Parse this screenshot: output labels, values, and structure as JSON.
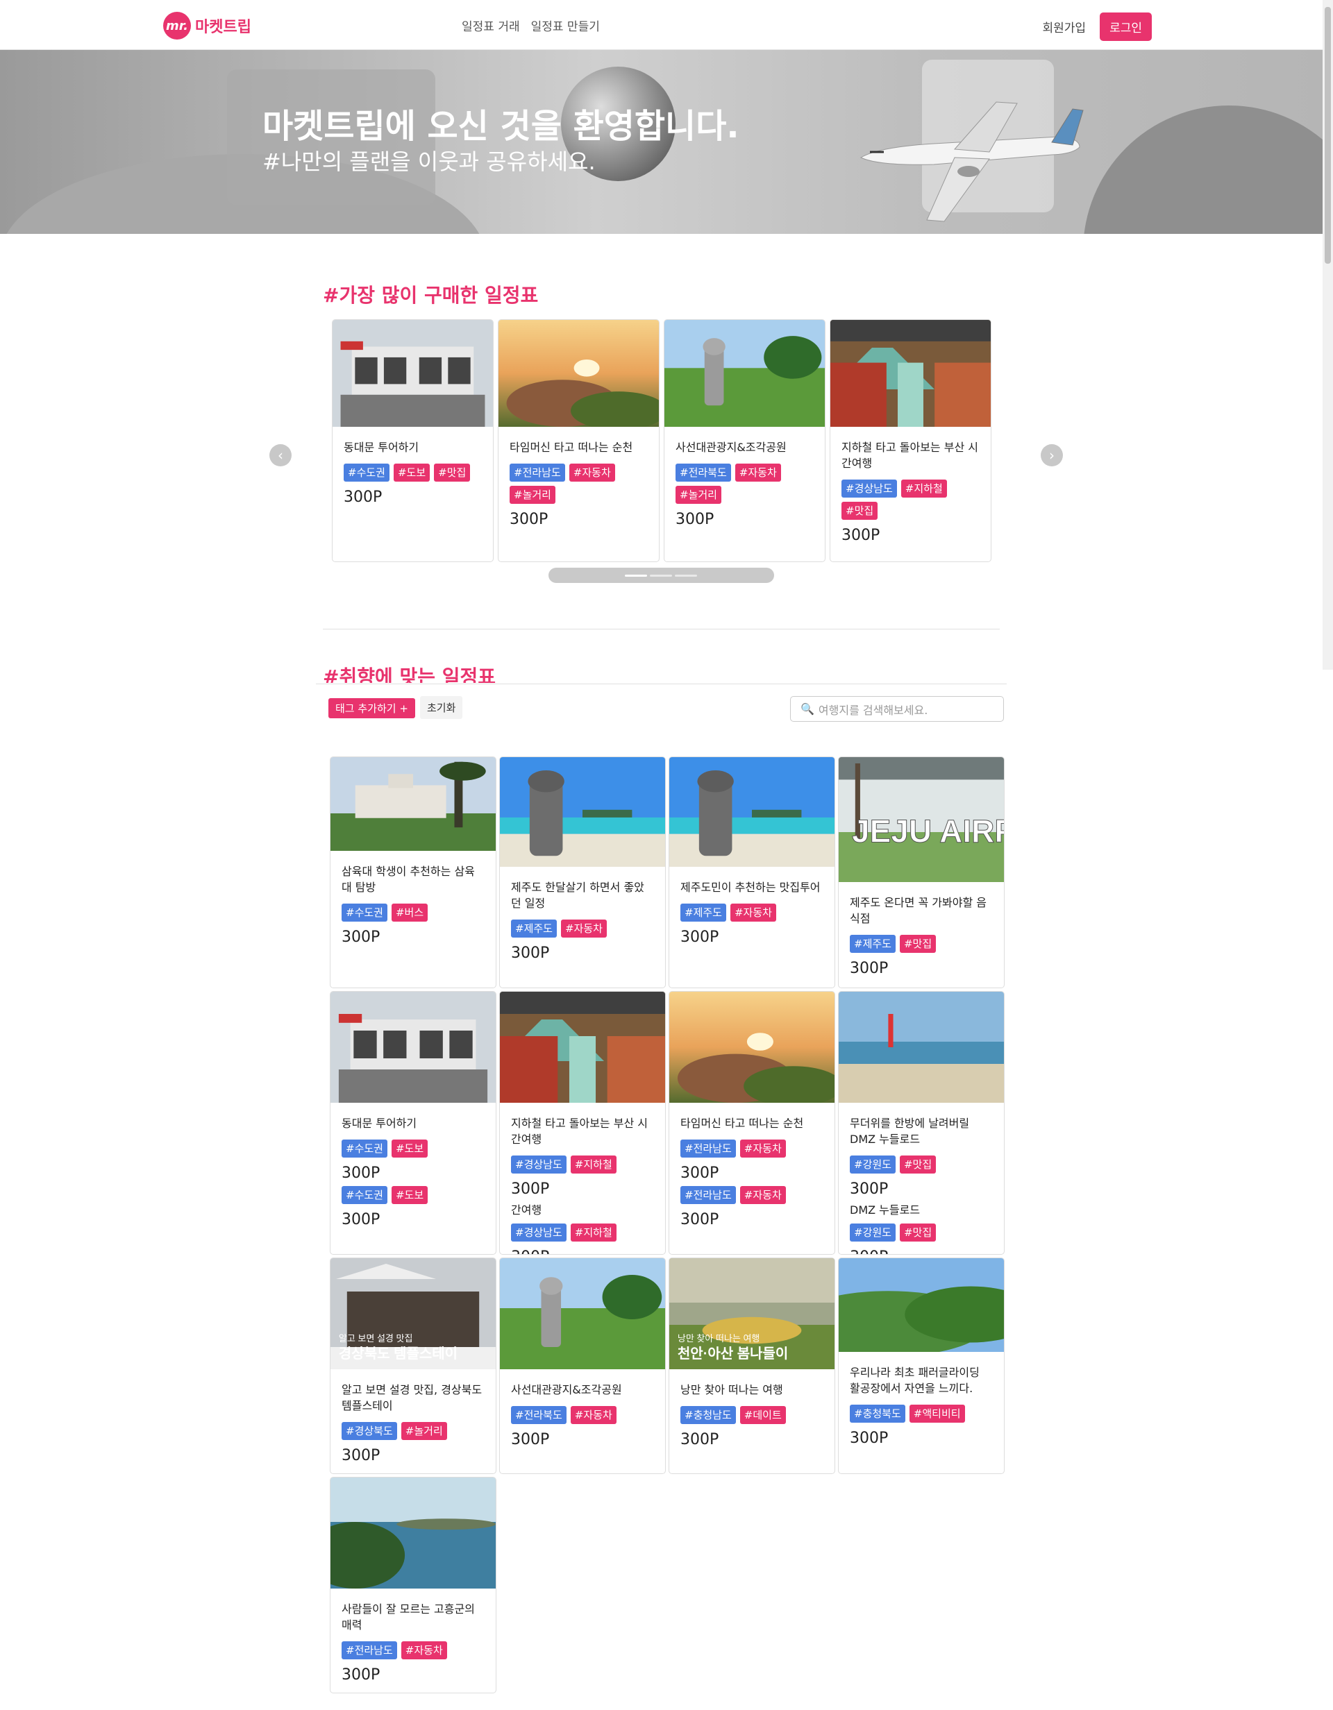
{
  "nav": {
    "logo_badge": "mr.",
    "logo_text": "마켓트립",
    "links": [
      "일정표 거래",
      "일정표 만들기"
    ],
    "signup": "회원가입",
    "login": "로그인"
  },
  "hero": {
    "title": "마켓트립에 오신 것을 환영합니다.",
    "subtitle": "#나만의 플랜을 이웃과 공유하세요."
  },
  "popular": {
    "title": "#가장 많이 구매한 일정표",
    "prev": "‹",
    "next": "›",
    "cards": [
      {
        "title": "동대문 투어하기",
        "tags": [
          [
            "#수도권",
            "blue"
          ],
          [
            "#도보",
            "pink"
          ],
          [
            "#맛집",
            "pink"
          ]
        ],
        "price": "300P",
        "img": "market"
      },
      {
        "title": "타임머신 타고 떠나는 순천",
        "tags": [
          [
            "#전라남도",
            "blue"
          ],
          [
            "#자동차",
            "pink"
          ],
          [
            "#놀거리",
            "pink"
          ]
        ],
        "price": "300P",
        "img": "sunset"
      },
      {
        "title": "사선대관광지&조각공원",
        "tags": [
          [
            "#전라북도",
            "blue"
          ],
          [
            "#자동차",
            "pink"
          ],
          [
            "#놀거리",
            "pink"
          ]
        ],
        "price": "300P",
        "img": "park"
      },
      {
        "title": "지하철 타고 돌아보는 부산 시간여행",
        "tags": [
          [
            "#경상남도",
            "blue"
          ],
          [
            "#지하철",
            "pink"
          ],
          [
            "#맛집",
            "pink"
          ]
        ],
        "price": "300P",
        "img": "fishmarket"
      }
    ]
  },
  "section2": {
    "title": "#취향에 맞는 일정표",
    "add_tag": "태그 추가하기 +",
    "reset": "초기화",
    "search_placeholder": "여행지를 검색해보세요."
  },
  "grid": [
    {
      "title": "삼육대 학생이 추천하는 삼육대 탐방",
      "tags": [
        [
          "#수도권",
          "blue"
        ],
        [
          "#버스",
          "pink"
        ]
      ],
      "price": "300P",
      "img": "campus"
    },
    {
      "title": "제주도 한달살기 하면서 좋았던 일정",
      "tags": [
        [
          "#제주도",
          "blue"
        ],
        [
          "#자동차",
          "pink"
        ]
      ],
      "price": "300P",
      "img": "jeju"
    },
    {
      "title": "제주도민이 추천하는 맛집투어",
      "tags": [
        [
          "#제주도",
          "blue"
        ],
        [
          "#자동차",
          "pink"
        ]
      ],
      "price": "300P",
      "img": "jeju"
    },
    {
      "title": "제주도 온다면 꼭 가봐야할 음식점",
      "tags": [
        [
          "#제주도",
          "blue"
        ],
        [
          "#맛집",
          "pink"
        ]
      ],
      "price": "300P",
      "img": "airport"
    },
    {
      "title": "동대문 투어하기",
      "tags": [
        [
          "#수도권",
          "blue"
        ],
        [
          "#도보",
          "pink"
        ]
      ],
      "price": "300P",
      "img": "market"
    },
    {
      "title": "지하철 타고 돌아보는 부산 시간여행",
      "tags": [
        [
          "#경상남도",
          "blue"
        ],
        [
          "#지하철",
          "pink"
        ]
      ],
      "price": "300P",
      "img": "fishmarket"
    },
    {
      "title": "타임머신 타고 떠나는 순천",
      "tags": [
        [
          "#전라남도",
          "blue"
        ],
        [
          "#자동차",
          "pink"
        ]
      ],
      "price": "300P",
      "img": "sunset"
    },
    {
      "title": "무더위를 한방에 날려버릴 DMZ 누들로드",
      "tags": [
        [
          "#강원도",
          "blue"
        ],
        [
          "#맛집",
          "pink"
        ]
      ],
      "price": "300P",
      "img": "beach"
    },
    {
      "title": "알고 보면 설경 맛집, 경상북도 템플스테이",
      "tags": [
        [
          "#경상북도",
          "blue"
        ],
        [
          "#놀거리",
          "pink"
        ]
      ],
      "price": "300P",
      "img": "temple"
    },
    {
      "title": "사선대관광지&조각공원",
      "tags": [
        [
          "#전라북도",
          "blue"
        ],
        [
          "#자동차",
          "pink"
        ]
      ],
      "price": "300P",
      "img": "park"
    },
    {
      "title": "낭만 찾아 떠나는 여행",
      "tags": [
        [
          "#충청남도",
          "blue"
        ],
        [
          "#데이트",
          "pink"
        ]
      ],
      "price": "300P",
      "img": "greenhouse"
    },
    {
      "title": "우리나라 최초 패러글라이딩 활공장에서 자연을 느끼다.",
      "tags": [
        [
          "#충청북도",
          "blue"
        ],
        [
          "#액티비티",
          "pink"
        ]
      ],
      "price": "300P",
      "img": "hill"
    },
    {
      "title": "사람들이 잘 모르는 고흥군의 매력",
      "tags": [
        [
          "#전라남도",
          "blue"
        ],
        [
          "#자동차",
          "pink"
        ]
      ],
      "price": "300P",
      "img": "coast"
    }
  ],
  "overlap": {
    "line2_left": "간여행",
    "line2_right": "DMZ 누들로드"
  },
  "img_captions": {
    "airport": "JEJU AIRPORT",
    "temple_small": "알고 보면 설경 맛집",
    "temple": "경상북도 템플스테이",
    "greenhouse_small": "낭만 찾아 떠나는 여행",
    "greenhouse": "천안·아산 봄나들이"
  },
  "colors": {
    "accent": "#e8336d",
    "tag_blue": "#4a7fe0"
  }
}
